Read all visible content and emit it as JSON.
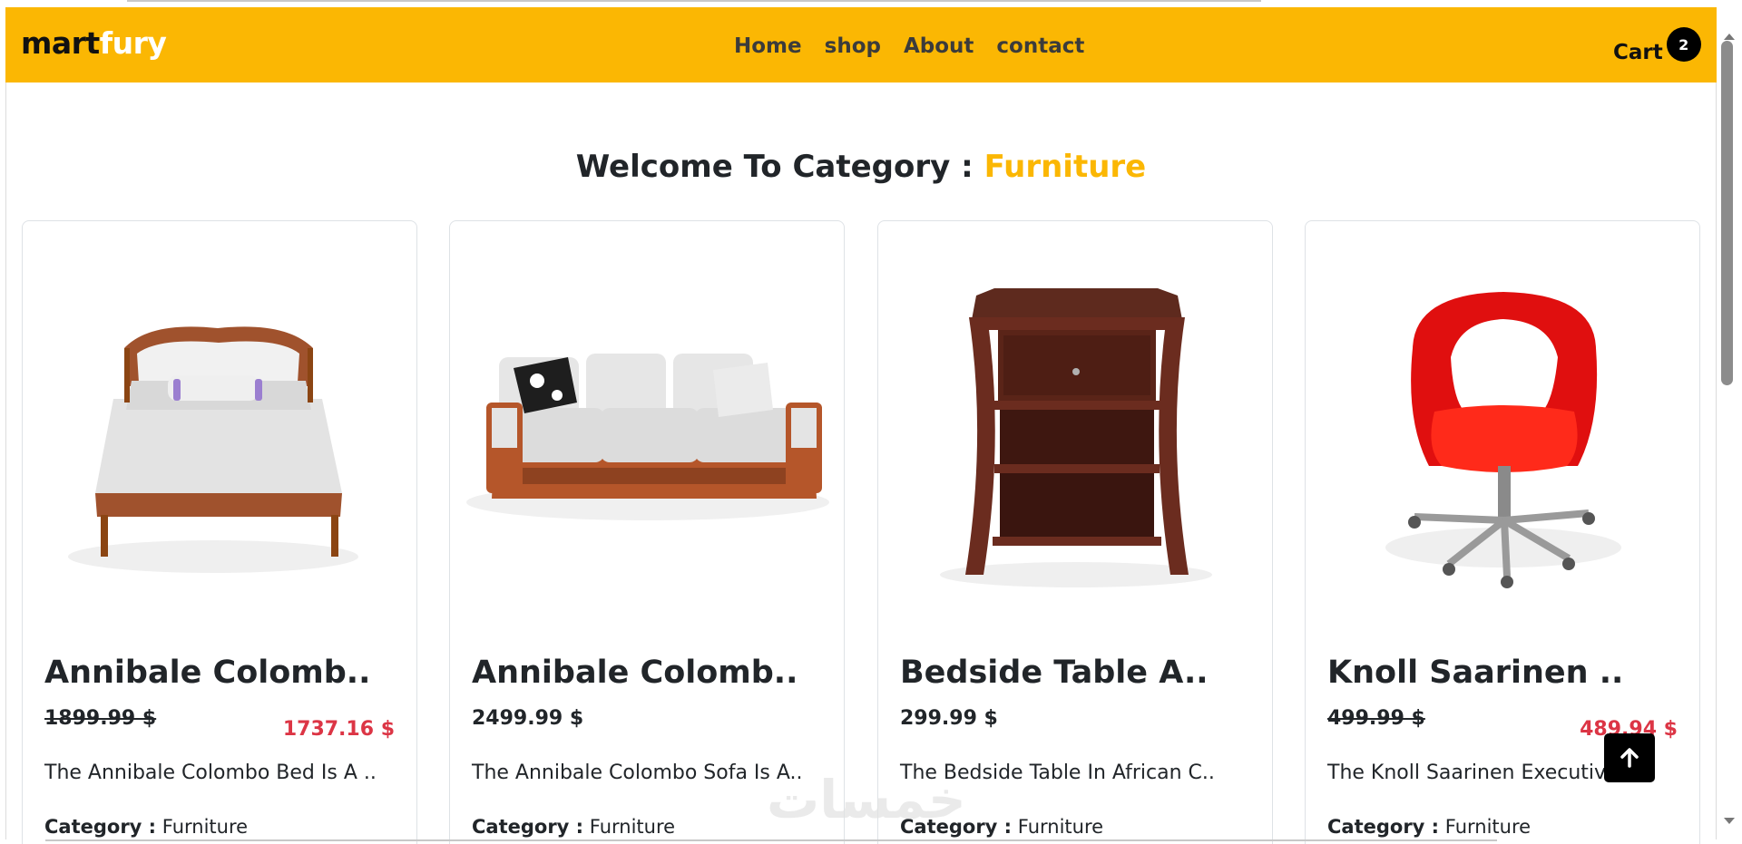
{
  "navbar": {
    "brand_part1": "mart",
    "brand_part2": "fury",
    "links": [
      {
        "label": "Home"
      },
      {
        "label": "shop"
      },
      {
        "label": "About"
      },
      {
        "label": "contact"
      }
    ],
    "cart_label": "Cart",
    "cart_count": "2"
  },
  "heading": {
    "prefix": "Welcome To Category : ",
    "category": "Furniture"
  },
  "products": [
    {
      "title": "Annibale Colomb..",
      "price_old": "1899.99 $",
      "price_new": "1737.16 $",
      "description": "The Annibale Colombo Bed Is A ..",
      "category_label": "Category :",
      "category_value": "Furniture",
      "image_icon": "bed-image"
    },
    {
      "title": "Annibale Colomb..",
      "price": "2499.99 $",
      "description": "The Annibale Colombo Sofa Is A..",
      "category_label": "Category :",
      "category_value": "Furniture",
      "image_icon": "sofa-image"
    },
    {
      "title": "Bedside Table A..",
      "price": "299.99 $",
      "description": "The Bedside Table In African C..",
      "category_label": "Category :",
      "category_value": "Furniture",
      "image_icon": "bedside-table-image"
    },
    {
      "title": "Knoll Saarinen ..",
      "price_old": "499.99 $",
      "price_new": "489.94 $",
      "description": "The Knoll Saarinen Executive ..",
      "category_label": "Category :",
      "category_value": "Furniture",
      "image_icon": "office-chair-image"
    }
  ],
  "watermark": "خمسات",
  "colors": {
    "brand_yellow": "#fbb703",
    "discount_red": "#dc3545",
    "text_dark": "#212529"
  }
}
